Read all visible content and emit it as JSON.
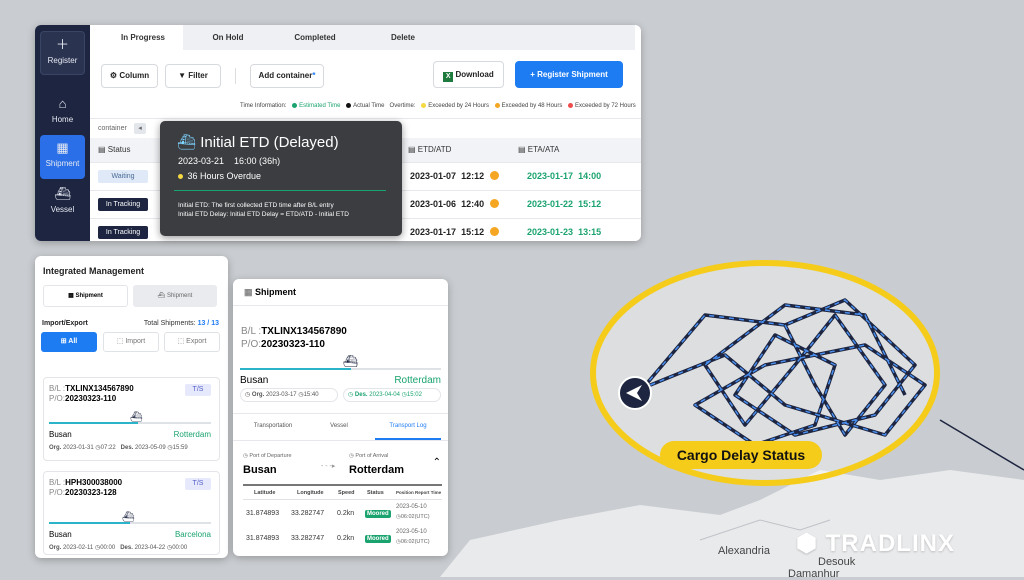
{
  "sidebar": {
    "register": "Register",
    "home": "Home",
    "shipment": "Shipment",
    "vessel": "Vessel"
  },
  "tabs": [
    "In Progress",
    "On Hold",
    "Completed",
    "Delete"
  ],
  "toolbar": {
    "column": "Column",
    "filter": "Filter",
    "add_container": "Add container",
    "download": "Download",
    "register_shipment": "+ Register Shipment"
  },
  "legend": {
    "time_info": "Time Information:",
    "estimated": "Estimated Time",
    "actual": "Actual Time",
    "overtime": "Overtime:",
    "h24": "Exceeded by 24 Hours",
    "h48": "Exceeded by 48 Hours",
    "h72": "Exceeded by 72 Hours"
  },
  "table": {
    "container_label": "container",
    "col_status": "Status",
    "col_etd": "ETD/ATD",
    "col_eta": "ETA/ATA",
    "rows": [
      {
        "status": "Waiting",
        "etd_date": "2023-01-07",
        "etd_time": "12:12",
        "eta_date": "2023-01-17",
        "eta_time": "14:00"
      },
      {
        "status": "In Tracking",
        "etd_date": "2023-01-06",
        "etd_time": "12:40",
        "eta_date": "2023-01-22",
        "eta_time": "15:12"
      },
      {
        "status": "In Tracking",
        "etd_date": "2023-01-17",
        "etd_time": "15:12",
        "eta_date": "2023-01-23",
        "eta_time": "13:15"
      }
    ]
  },
  "tooltip": {
    "title": "Initial ETD (Delayed)",
    "datetime": "2023-03-21    16:00 (36h)",
    "overdue": "36 Hours Overdue",
    "note1": "Initial ETD: The first collected ETD time after B/L entry",
    "note2": "Initial ETD Delay: Initial ETD Delay = ETD/ATD - Initial ETD"
  },
  "integrated": {
    "title": "Integrated Management",
    "tab1": "Shipment",
    "tab2": "Shipment",
    "import_export": "Import/Export",
    "total_label": "Total Shipments:",
    "total_value": "13 / 13",
    "filter_all": "All",
    "filter_import": "Import",
    "filter_export": "Export",
    "cards": [
      {
        "bl_label": "B/L :",
        "bl": "TXLINX134567890",
        "po_label": "P/O:",
        "po": "20230323-110",
        "badge": "T/S",
        "from": "Busan",
        "to": "Rotterdam",
        "org_label": "Org.",
        "org_date": "2023-01-31",
        "org_time": "07:22",
        "des_label": "Des.",
        "des_date": "2023-05-09",
        "des_time": "15:59",
        "progress": 0.55
      },
      {
        "bl_label": "B/L :",
        "bl": "HPH300038000",
        "po_label": "P/O:",
        "po": "20230323-128",
        "badge": "T/S",
        "from": "Busan",
        "to": "Barcelona",
        "org_label": "Org.",
        "org_date": "2023-02-11",
        "org_time": "00:00",
        "des_label": "Des.",
        "des_date": "2023-04-22",
        "des_time": "00:00",
        "progress": 0.5
      }
    ]
  },
  "shipment": {
    "title": "Shipment",
    "bl_label": "B/L :",
    "bl": "TXLINX134567890",
    "po_label": "P/O:",
    "po": "20230323-110",
    "from": "Busan",
    "to": "Rotterdam",
    "org_label": "Org.",
    "org_date": "2023-03-17",
    "org_time": "15:40",
    "des_label": "Des.",
    "des_date": "2023-04-04",
    "des_time": "15:02",
    "progress": 0.55,
    "tabs": [
      "Transportation",
      "Vessel",
      "Transport Log"
    ],
    "pod_label": "Port of Departure",
    "poa_label": "Port of Arrival",
    "pod": "Busan",
    "poa": "Rotterdam",
    "log_headers": [
      "Latitude",
      "Longitude",
      "Speed",
      "Status",
      "Position Report Time"
    ],
    "log_rows": [
      {
        "lat": "31.874893",
        "lon": "33.282747",
        "speed": "0.2kn",
        "status": "Moored",
        "date": "2023-05-10",
        "time": "06:02(UTC)"
      },
      {
        "lat": "31.874893",
        "lon": "33.282747",
        "speed": "0.2kn",
        "status": "Moored",
        "date": "2023-05-10",
        "time": "06:02(UTC)"
      }
    ]
  },
  "map": {
    "label": "Cargo Delay Status",
    "city1": "Alexandria",
    "city2": "Desouk",
    "city3": "Damanhur"
  },
  "brand": "TRADLINX",
  "colors": {
    "accent": "#1e7cf2",
    "navy": "#1d2540",
    "yellow": "#f5cc1a",
    "green": "#1aa36f",
    "orange": "#f5a623"
  }
}
